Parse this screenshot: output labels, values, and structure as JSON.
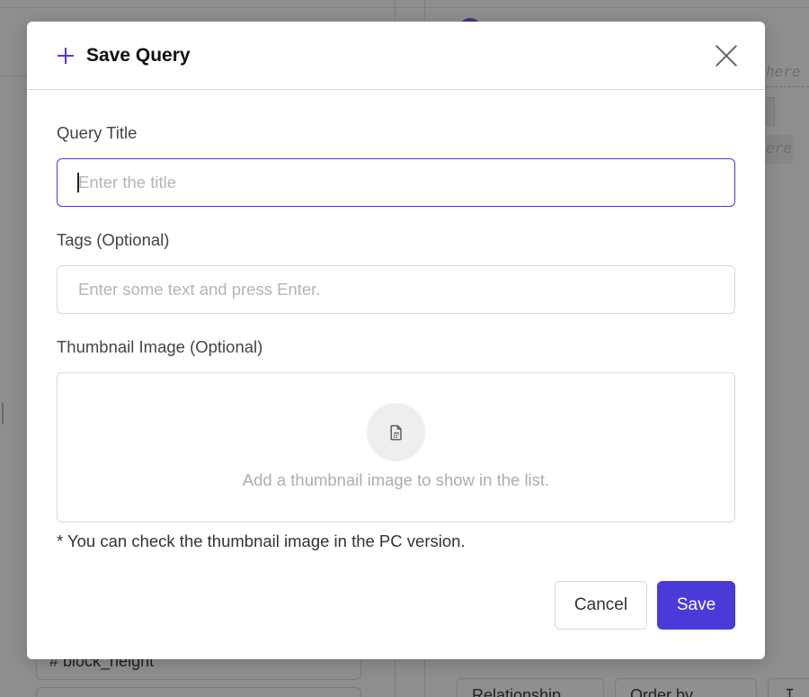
{
  "modal": {
    "title": "Save Query",
    "fields": {
      "title_label": "Query Title",
      "title_value": "",
      "title_placeholder": "Enter the title",
      "tags_label": "Tags (Optional)",
      "tags_value": "",
      "tags_placeholder": "Enter some text and press Enter.",
      "thumbnail_label": "Thumbnail Image (Optional)",
      "thumbnail_hint": "Add a thumbnail image to show in the list."
    },
    "note": "* You can check the thumbnail image in the PC version.",
    "buttons": {
      "cancel": "Cancel",
      "save": "Save"
    },
    "icons": {
      "header": "plus-icon",
      "close": "close-icon",
      "thumbnail": "file-document-icon"
    }
  },
  "background": {
    "field_partial": "# block_height",
    "where_text_1": "here",
    "where_text_2": "ere",
    "buttons": [
      "Relationship",
      "Order by",
      "↧"
    ]
  },
  "colors": {
    "accent": "#4a3bd8",
    "overlay": "#8e8e8e"
  }
}
